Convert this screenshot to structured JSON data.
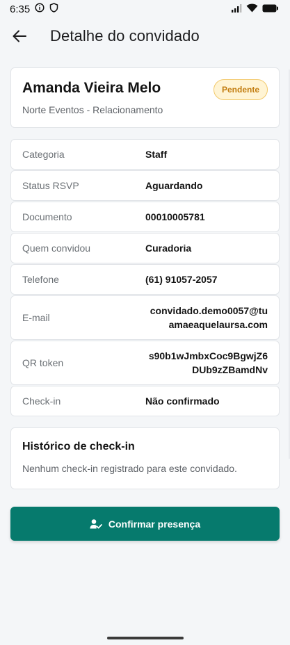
{
  "status_bar": {
    "time": "6:35"
  },
  "header": {
    "title": "Detalhe do convidado"
  },
  "guest": {
    "name": "Amanda Vieira Melo",
    "subtitle": "Norte Eventos - Relacionamento",
    "status_badge": "Pendente"
  },
  "details": [
    {
      "label": "Categoria",
      "value": "Staff"
    },
    {
      "label": "Status RSVP",
      "value": "Aguardando"
    },
    {
      "label": "Documento",
      "value": "00010005781"
    },
    {
      "label": "Quem convidou",
      "value": "Curadoria"
    },
    {
      "label": "Telefone",
      "value": "(61) 91057-2057"
    },
    {
      "label": "E-mail",
      "value": "convidado.demo0057@tuamaeaquelaursa.com"
    },
    {
      "label": "QR token",
      "value": "s90b1wJmbxCoc9BgwjZ6DUb9zZBamdNv"
    },
    {
      "label": "Check-in",
      "value": "Não confirmado"
    }
  ],
  "history": {
    "title": "Histórico de check-in",
    "empty_text": "Nenhum check-in registrado para este convidado."
  },
  "actions": {
    "confirm_label": "Confirmar presença"
  },
  "colors": {
    "primary": "#067a6d",
    "badge_bg": "#fff4d4",
    "badge_text": "#c27c0e"
  },
  "icons": {
    "back": "arrow-left-icon",
    "confirm": "person-check-icon"
  }
}
